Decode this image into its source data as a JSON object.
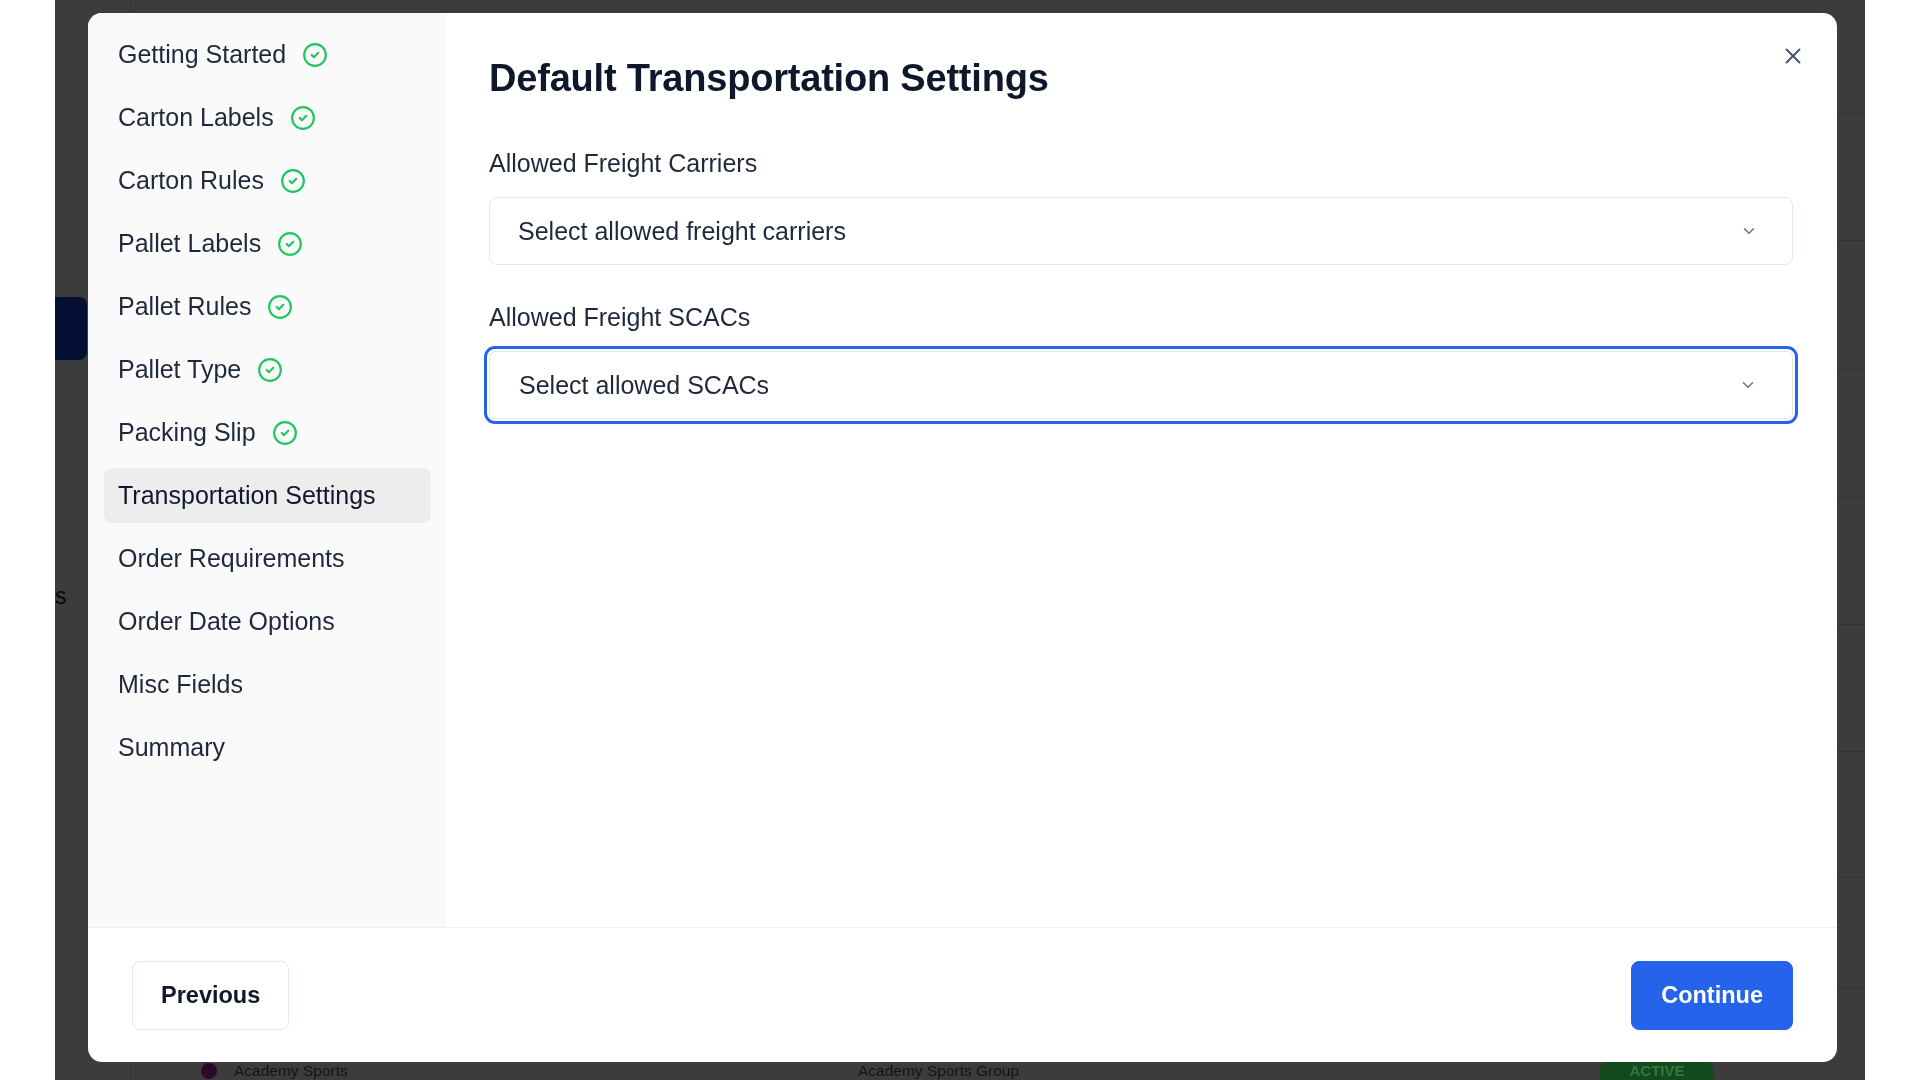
{
  "background_page": {
    "nav": {
      "label_fragment": "s"
    },
    "rows": [
      {
        "name": "Academy Sports",
        "color": "#2a0a26",
        "group": "Academy Sports Group",
        "status": "ACTIVE"
      }
    ]
  },
  "dialog": {
    "steps": [
      {
        "label": "Getting Started",
        "completed": true,
        "selected": false
      },
      {
        "label": "Carton Labels",
        "completed": true,
        "selected": false
      },
      {
        "label": "Carton Rules",
        "completed": true,
        "selected": false
      },
      {
        "label": "Pallet Labels",
        "completed": true,
        "selected": false
      },
      {
        "label": "Pallet Rules",
        "completed": true,
        "selected": false
      },
      {
        "label": "Pallet Type",
        "completed": true,
        "selected": false
      },
      {
        "label": "Packing Slip",
        "completed": true,
        "selected": false
      },
      {
        "label": "Transportation Settings",
        "completed": false,
        "selected": true
      },
      {
        "label": "Order Requirements",
        "completed": false,
        "selected": false
      },
      {
        "label": "Order Date Options",
        "completed": false,
        "selected": false
      },
      {
        "label": "Misc Fields",
        "completed": false,
        "selected": false
      },
      {
        "label": "Summary",
        "completed": false,
        "selected": false
      }
    ],
    "title": "Default Transportation Settings",
    "fields": [
      {
        "label": "Allowed Freight Carriers",
        "placeholder": "Select allowed freight carriers",
        "focused": false
      },
      {
        "label": "Allowed Freight SCACs",
        "placeholder": "Select allowed SCACs",
        "focused": true
      }
    ],
    "buttons": [
      {
        "label": "Previous",
        "kind": "secondary"
      },
      {
        "label": "Continue",
        "kind": "primary"
      }
    ]
  }
}
